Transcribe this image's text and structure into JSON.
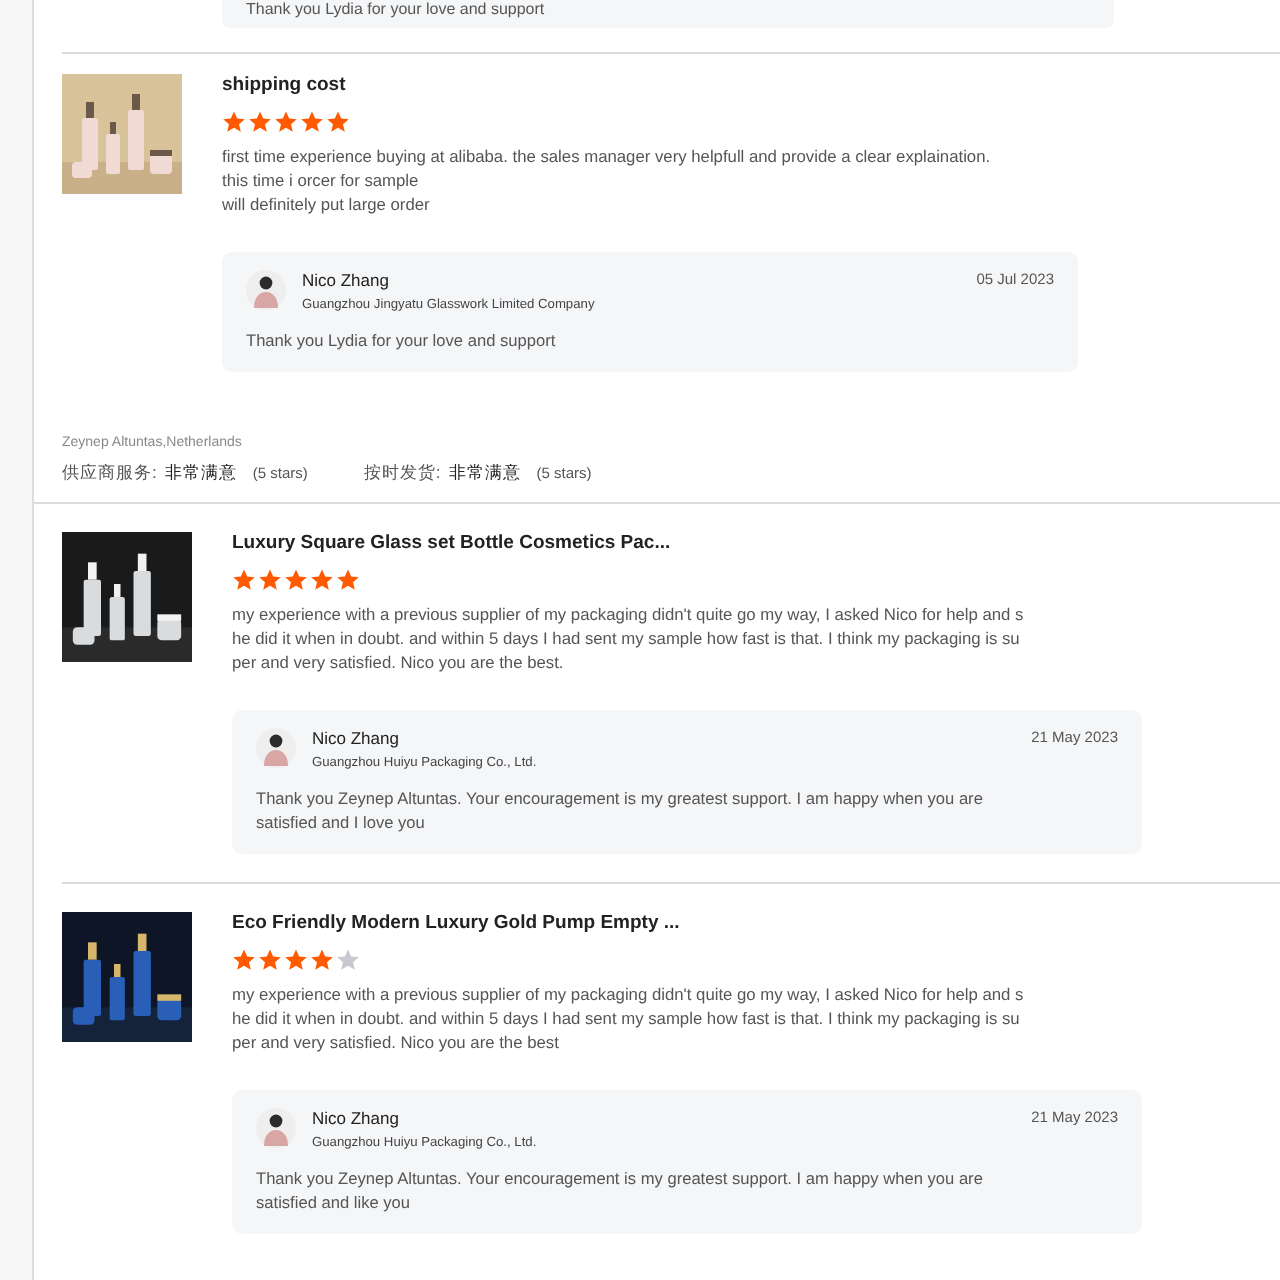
{
  "top_reply": {
    "text": "Thank you Lydia for your love and support"
  },
  "reviews": [
    {
      "title": "shipping cost",
      "stars": 5,
      "lines": [
        "first time experience buying at alibaba. the sales manager very helpfull and provide a clear explaination.",
        "this time i orcer for sample",
        "will definitely put large order"
      ],
      "reply": {
        "name": "Nico Zhang",
        "company": "Guangzhou Jingyatu Glasswork Limited Company",
        "date": "05 Jul 2023",
        "lines": [
          "Thank you Lydia for your love and support"
        ]
      }
    },
    {
      "reviewer": {
        "name": "Zeynep Altuntas,Netherlands",
        "ratings": [
          {
            "label": "供应商服务:",
            "value": "非常满意",
            "note": "(5 stars)"
          },
          {
            "label": "按时发货:",
            "value": "非常满意",
            "note": "(5 stars)"
          }
        ]
      },
      "title": "Luxury Square Glass set Bottle Cosmetics Pac...",
      "stars": 5,
      "lines": [
        "my experience with a previous supplier of my packaging didn't quite go my way, I asked Nico for help and s",
        "he did it when in doubt. and within 5 days I had sent my sample how fast is that. I think my packaging is su",
        "per and very satisfied. Nico  you are the best."
      ],
      "reply": {
        "name": "Nico Zhang",
        "company": "Guangzhou Huiyu Packaging Co., Ltd.",
        "date": "21 May 2023",
        "lines": [
          "Thank you Zeynep Altuntas. Your encouragement is my greatest support. I am happy when you are",
          "satisfied and I love you"
        ]
      }
    },
    {
      "title": "Eco Friendly Modern Luxury Gold Pump Empty ...",
      "stars": 4,
      "lines": [
        "my experience with a previous supplier of my packaging didn't quite go my way, I asked Nico for help and s",
        "he did it when in doubt. and within 5 days I had sent my sample how fast is that. I think my packaging is su",
        "per and very satisfied. Nico you are the best"
      ],
      "reply": {
        "name": "Nico Zhang",
        "company": "Guangzhou Huiyu Packaging Co., Ltd.",
        "date": "21 May 2023",
        "lines": [
          "Thank you Zeynep Altuntas. Your encouragement is my greatest support. I am happy when you are",
          "satisfied and like you"
        ]
      }
    }
  ]
}
